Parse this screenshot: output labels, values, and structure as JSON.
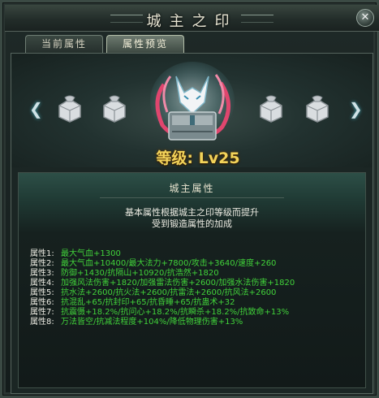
{
  "window": {
    "title": "城主之印",
    "close_label": "✕"
  },
  "tabs": [
    {
      "label": "当前属性",
      "active": false
    },
    {
      "label": "属性预览",
      "active": true
    }
  ],
  "showcase": {
    "prev_arrow": "❮",
    "next_arrow": "❯",
    "level_text": "等级: Lv25",
    "seal_count_left": 2,
    "seal_count_right": 2
  },
  "attributes": {
    "section_title": "城主属性",
    "description_line1": "基本属性根据城主之印等级而提升",
    "description_line2": "受到锻造属性的加成",
    "rows": [
      {
        "label": "属性1:",
        "value": "最大气血+1300"
      },
      {
        "label": "属性2:",
        "value": "最大气血+10400/最大法力+7800/攻击+3640/速度+260"
      },
      {
        "label": "属性3:",
        "value": "防御+1430/抗隔山+10920/抗浩然+1820"
      },
      {
        "label": "属性4:",
        "value": "加强风法伤害+1820/加强雷法伤害+2600/加强水法伤害+1820"
      },
      {
        "label": "属性5:",
        "value": "抗水法+2600/抗火法+2600/抗雷法+2600/抗风法+2600"
      },
      {
        "label": "属性6:",
        "value": "抗混乱+65/抗封印+65/抗昏睡+65/抗蛊术+32"
      },
      {
        "label": "属性7:",
        "value": "抗震慑+18.2%/抗问心+18.2%/抗瞬杀+18.2%/抗致命+13%"
      },
      {
        "label": "属性8:",
        "value": "万法皆空/抗减法程度+104%/降低物理伤害+13%"
      }
    ]
  },
  "colors": {
    "accent_gold": "#f2d35a",
    "attr_green": "#41d23a",
    "text_light": "#ecebe2"
  }
}
